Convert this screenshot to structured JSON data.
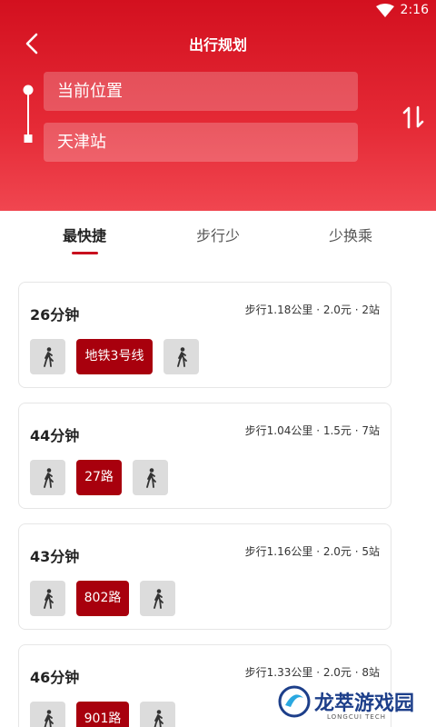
{
  "status": {
    "time": "2:16"
  },
  "header": {
    "title": "出行规划"
  },
  "route": {
    "from": "当前位置",
    "to": "天津站"
  },
  "tabs": [
    {
      "label": "最快捷",
      "active": true
    },
    {
      "label": "步行少",
      "active": false
    },
    {
      "label": "少换乘",
      "active": false
    }
  ],
  "results": [
    {
      "duration": "26分钟",
      "meta": "步行1.18公里 · 2.0元 · 2站",
      "line": "地铁3号线"
    },
    {
      "duration": "44分钟",
      "meta": "步行1.04公里 · 1.5元 · 7站",
      "line": "27路"
    },
    {
      "duration": "43分钟",
      "meta": "步行1.16公里 · 2.0元 · 5站",
      "line": "802路"
    },
    {
      "duration": "46分钟",
      "meta": "步行1.33公里 · 2.0元 · 8站",
      "line": "901路"
    }
  ],
  "watermark": {
    "title": "龙萃游戏园",
    "subtitle": "LONGCUI TECH"
  },
  "colors": {
    "brand_red": "#d3101f",
    "line_badge": "#a8000d"
  }
}
